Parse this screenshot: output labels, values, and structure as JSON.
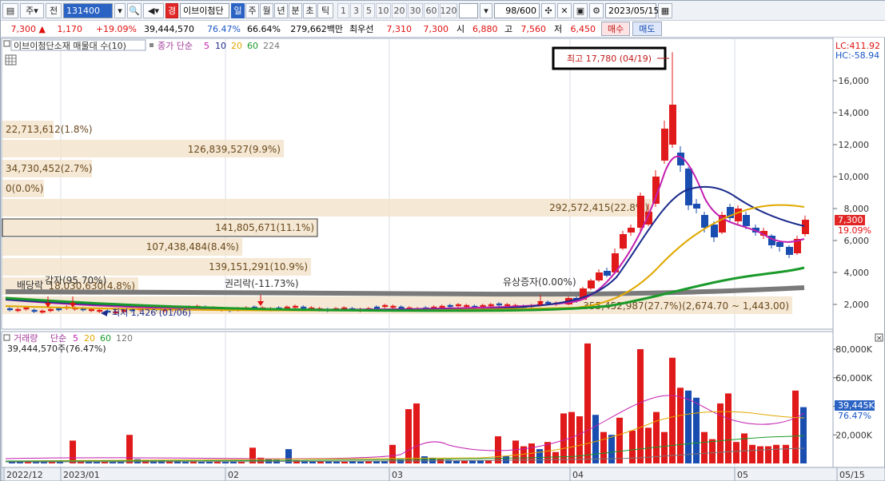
{
  "toolbar": {
    "period_marker": "주",
    "type_btn": "전",
    "code": "131400",
    "badge": "경",
    "stock_name": "이브이첨단",
    "periods": [
      "일",
      "주",
      "월",
      "년",
      "분",
      "초",
      "틱"
    ],
    "active_period": "일",
    "minutes": [
      "1",
      "3",
      "5",
      "10",
      "20",
      "30",
      "60",
      "120"
    ],
    "count": "98/600",
    "date": "2023/05/15"
  },
  "quote": {
    "price": "7,300",
    "change": "1,170",
    "change_pct": "+19.09%",
    "volume": "39,444,570",
    "vol_pct": "76.47%",
    "turnover": "66.64%",
    "amount": "279,662백만",
    "pref_label": "최우선",
    "ask": "7,310",
    "bid": "7,300",
    "open_label": "시",
    "open": "6,880",
    "high_label": "고",
    "high": "7,560",
    "low_label": "저",
    "low": "6,450",
    "buy": "매수",
    "sell": "매도"
  },
  "price_panel": {
    "title": "이브이첨단소재 매물대 수(10)",
    "ma_label": "종가 단순",
    "ma_periods": [
      {
        "label": "5",
        "color": "#c21fb0"
      },
      {
        "label": "10",
        "color": "#1a2a8c"
      },
      {
        "label": "20",
        "color": "#e0a800"
      },
      {
        "label": "60",
        "color": "#1a9a2a"
      },
      {
        "label": "224",
        "color": "#777777"
      }
    ],
    "lc": "LC:411.92",
    "hc": "HC:-58.94",
    "high_note": "최고 17,780 (04/19)",
    "low_note": "최저 1,426 (01/06)",
    "current_price_tag": "7,300",
    "current_pct_tag": "19.09%",
    "y_ticks": [
      "16,000",
      "14,000",
      "12,000",
      "10,000",
      "8,000",
      "6,000",
      "4,000",
      "2,000"
    ],
    "volume_profile": [
      "22,713,612(1.8%)",
      "126,839,527(9.9%)",
      "34,730,452(2.7%)",
      "0(0.0%)",
      "292,572,415(22.8%)",
      "141,805,671(11.1%)",
      "107,438,484(8.4%)",
      "139,151,291(10.9%)",
      "18,030,630(4.8%)",
      "355,452,987(27.7%)(2,674.70 ~ 1,443.00)"
    ],
    "events": [
      "감자(95.70%)",
      "배당락",
      "권리락(-11.73%)",
      "유상증자(0.00%)"
    ]
  },
  "volume_panel": {
    "title": "거래량",
    "ma_label": "단순",
    "ma_periods": [
      {
        "label": "5",
        "color": "#c21fb0"
      },
      {
        "label": "20",
        "color": "#e0a800"
      },
      {
        "label": "60",
        "color": "#1a9a2a"
      },
      {
        "label": "120",
        "color": "#777777"
      }
    ],
    "current": "39,444,570주(76.47%)",
    "y_ticks": [
      "80,000K",
      "60,000K",
      "40,000K",
      "20,000K"
    ],
    "current_tag": "39,445K",
    "current_pct": "76.47%"
  },
  "x_axis": [
    "2022/12",
    "2023/01",
    "02",
    "03",
    "04",
    "05",
    "05/15"
  ],
  "chart_data": {
    "type": "candlestick",
    "x": [
      "2022/12",
      "2023/01",
      "02",
      "03",
      "04",
      "05"
    ],
    "y_range": [
      1000,
      18000
    ],
    "volume_range": [
      0,
      85000000
    ],
    "last_close": 7300,
    "high_point": {
      "value": 17780,
      "date": "04/19"
    },
    "low_point": {
      "value": 1426,
      "date": "01/06"
    }
  }
}
